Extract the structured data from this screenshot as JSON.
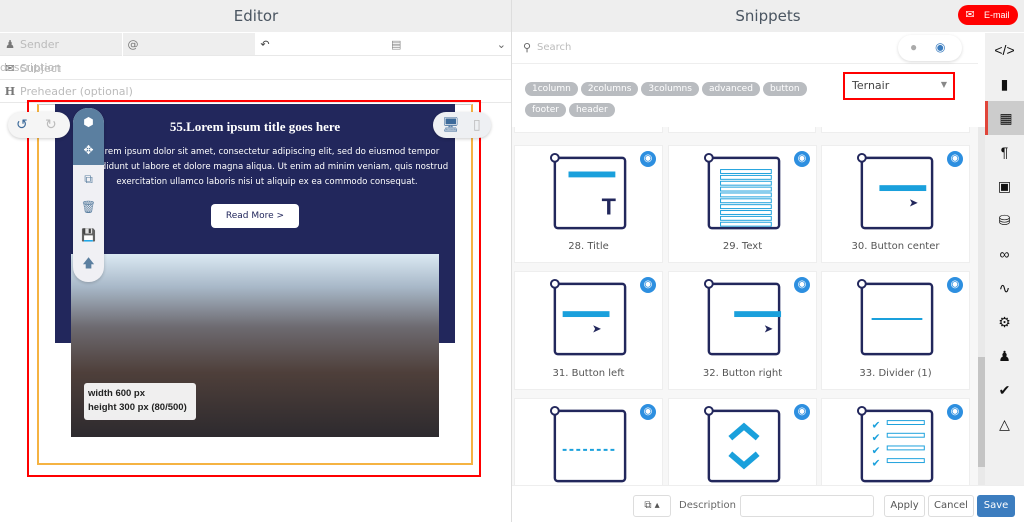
{
  "editor": {
    "title": "Editor",
    "sender_placeholder": "Sender description",
    "at_symbol": "@",
    "subject_placeholder": "Subject",
    "preheader_placeholder": "Preheader (optional)"
  },
  "email": {
    "title": "55.Lorem ipsum title goes here",
    "body": "Lorem ipsum dolor sit amet, consectetur adipiscing elit, sed do eiusmod tempor incididunt ut labore et dolore magna aliqua. Ut enim ad minim veniam, quis nostrud exercitation ullamco laboris nisi ut aliquip ex ea commodo consequat.",
    "button": "Read More >",
    "image_info_1": "width 600 px",
    "image_info_2": "height 300 px (80/500)"
  },
  "snippets": {
    "title": "Snippets",
    "email_button": "E-mail",
    "search_placeholder": "Search",
    "tags": [
      "1column",
      "2columns",
      "3columns",
      "advanced",
      "button",
      "footer",
      "header"
    ],
    "select_value": "Ternair",
    "items": [
      {
        "label": "28. Title",
        "icon": "title"
      },
      {
        "label": "29. Text",
        "icon": "text"
      },
      {
        "label": "30. Button center",
        "icon": "btn-center"
      },
      {
        "label": "31. Button left",
        "icon": "btn-left"
      },
      {
        "label": "32. Button right",
        "icon": "btn-right"
      },
      {
        "label": "33. Divider (1)",
        "icon": "divider"
      },
      {
        "label": "",
        "icon": "dashed"
      },
      {
        "label": "",
        "icon": "chevrons"
      },
      {
        "label": "",
        "icon": "checklist"
      }
    ]
  },
  "footer": {
    "description_label": "Description",
    "description_value": "",
    "apply": "Apply",
    "cancel": "Cancel",
    "save": "Save"
  },
  "sidebar": [
    "code-icon",
    "file-icon",
    "grid-icon",
    "paragraph-icon",
    "image-icon",
    "database-icon",
    "link-icon",
    "rss-icon",
    "gear-icon",
    "users-icon",
    "check-icon",
    "flask-icon"
  ],
  "colors": {
    "navy": "#22275c",
    "accent": "#1aa0dc",
    "red": "#f00",
    "save": "#3c7dbf"
  }
}
